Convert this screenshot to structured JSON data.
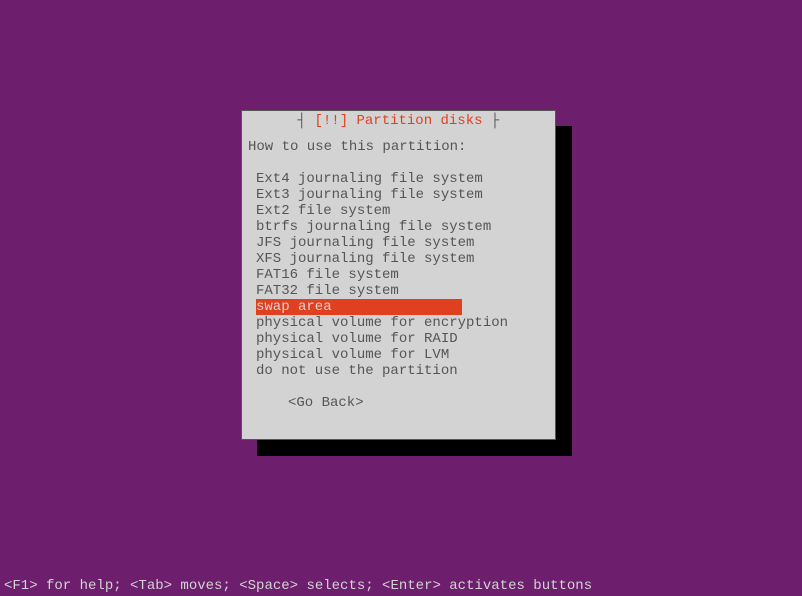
{
  "dialog": {
    "border_left": "┤ ",
    "title_alert": "[!!]",
    "title_text": " Partition disks",
    "border_right": " ├",
    "prompt": "How to use this partition:",
    "options": [
      "Ext4 journaling file system",
      "Ext3 journaling file system",
      "Ext2 file system",
      "btrfs journaling file system",
      "JFS journaling file system",
      "XFS journaling file system",
      "FAT16 file system",
      "FAT32 file system",
      "swap area",
      "physical volume for encryption",
      "physical volume for RAID",
      "physical volume for LVM",
      "do not use the partition"
    ],
    "selected_index": 8,
    "go_back": "<Go Back>"
  },
  "footer": "<F1> for help; <Tab> moves; <Space> selects; <Enter> activates buttons"
}
